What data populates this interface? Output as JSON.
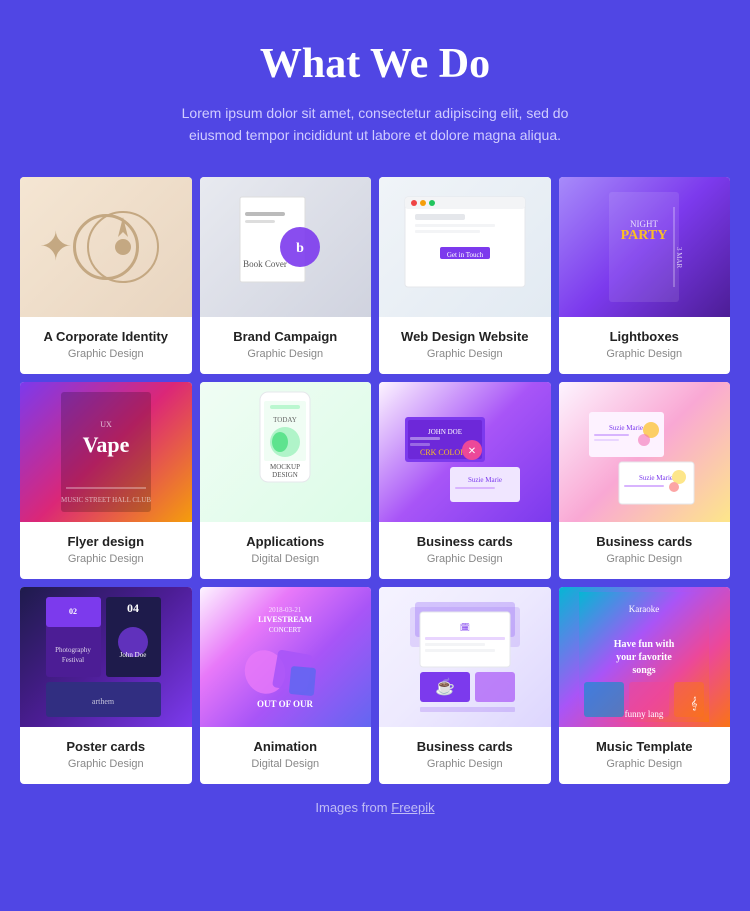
{
  "header": {
    "title": "What We Do",
    "subtitle": "Lorem ipsum dolor sit amet, consectetur adipiscing elit, sed do eiusmod tempor incididunt ut labore et dolore magna aliqua."
  },
  "grid_rows": [
    [
      {
        "id": "corporate",
        "title": "A Corporate Identity",
        "category": "Graphic Design",
        "img_class": "img-corporate"
      },
      {
        "id": "brand",
        "title": "Brand Campaign",
        "category": "Graphic Design",
        "img_class": "img-brand"
      },
      {
        "id": "webdesign",
        "title": "Web Design Website",
        "category": "Graphic Design",
        "img_class": "img-webdesign"
      },
      {
        "id": "lightboxes",
        "title": "Lightboxes",
        "category": "Graphic Design",
        "img_class": "img-lightboxes"
      }
    ],
    [
      {
        "id": "flyer",
        "title": "Flyer design",
        "category": "Graphic Design",
        "img_class": "img-flyer"
      },
      {
        "id": "apps",
        "title": "Applications",
        "category": "Digital Design",
        "img_class": "img-apps"
      },
      {
        "id": "bizcard1",
        "title": "Business cards",
        "category": "Graphic Design",
        "img_class": "img-bizcard1"
      },
      {
        "id": "bizcard2",
        "title": "Business cards",
        "category": "Graphic Design",
        "img_class": "img-bizcard2"
      }
    ],
    [
      {
        "id": "poster",
        "title": "Poster cards",
        "category": "Graphic Design",
        "img_class": "img-poster"
      },
      {
        "id": "animation",
        "title": "Animation",
        "category": "Digital Design",
        "img_class": "img-animation"
      },
      {
        "id": "bizcard3",
        "title": "Business cards",
        "category": "Graphic Design",
        "img_class": "img-bizcard3"
      },
      {
        "id": "music",
        "title": "Music Template",
        "category": "Graphic Design",
        "img_class": "img-music"
      }
    ]
  ],
  "footer": {
    "text": "Images from",
    "link_text": "Freepik"
  }
}
